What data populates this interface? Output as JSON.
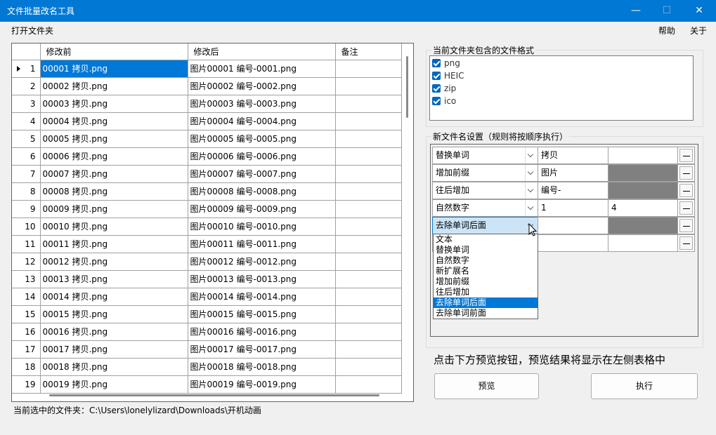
{
  "window": {
    "title": "文件批量改名工具",
    "minimize_glyph": "—",
    "maximize_glyph": "☐",
    "close_glyph": "✕"
  },
  "menu": {
    "open_folder": "打开文件夹",
    "help": "帮助",
    "about": "关于"
  },
  "file_grid": {
    "columns": [
      "修改前",
      "修改后",
      "备注"
    ],
    "rows": [
      {
        "n": "1",
        "before": "00001 拷贝.png",
        "after": "图片00001 编号-0001.png",
        "note": ""
      },
      {
        "n": "2",
        "before": "00002 拷贝.png",
        "after": "图片00002 编号-0002.png",
        "note": ""
      },
      {
        "n": "3",
        "before": "00003 拷贝.png",
        "after": "图片00003 编号-0003.png",
        "note": ""
      },
      {
        "n": "4",
        "before": "00004 拷贝.png",
        "after": "图片00004 编号-0004.png",
        "note": ""
      },
      {
        "n": "5",
        "before": "00005 拷贝.png",
        "after": "图片00005 编号-0005.png",
        "note": ""
      },
      {
        "n": "6",
        "before": "00006 拷贝.png",
        "after": "图片00006 编号-0006.png",
        "note": ""
      },
      {
        "n": "7",
        "before": "00007 拷贝.png",
        "after": "图片00007 编号-0007.png",
        "note": ""
      },
      {
        "n": "8",
        "before": "00008 拷贝.png",
        "after": "图片00008 编号-0008.png",
        "note": ""
      },
      {
        "n": "9",
        "before": "00009 拷贝.png",
        "after": "图片00009 编号-0009.png",
        "note": ""
      },
      {
        "n": "10",
        "before": "00010 拷贝.png",
        "after": "图片00010 编号-0010.png",
        "note": ""
      },
      {
        "n": "11",
        "before": "00011 拷贝.png",
        "after": "图片00011 编号-0011.png",
        "note": ""
      },
      {
        "n": "12",
        "before": "00012 拷贝.png",
        "after": "图片00012 编号-0012.png",
        "note": ""
      },
      {
        "n": "13",
        "before": "00013 拷贝.png",
        "after": "图片00013 编号-0013.png",
        "note": ""
      },
      {
        "n": "14",
        "before": "00014 拷贝.png",
        "after": "图片00014 编号-0014.png",
        "note": ""
      },
      {
        "n": "15",
        "before": "00015 拷贝.png",
        "after": "图片00015 编号-0015.png",
        "note": ""
      },
      {
        "n": "16",
        "before": "00016 拷贝.png",
        "after": "图片00016 编号-0016.png",
        "note": ""
      },
      {
        "n": "17",
        "before": "00017 拷贝.png",
        "after": "图片00017 编号-0017.png",
        "note": ""
      },
      {
        "n": "18",
        "before": "00018 拷贝.png",
        "after": "图片00018 编号-0018.png",
        "note": ""
      },
      {
        "n": "19",
        "before": "00019 拷贝.png",
        "after": "图片00019 编号-0019.png",
        "note": ""
      }
    ]
  },
  "status": {
    "current_folder": "当前选中的文件夹：C:\\Users\\lonelylizard\\Downloads\\开机动画"
  },
  "formats": {
    "legend": "当前文件夹包含的文件格式",
    "items": [
      {
        "label": "png",
        "checked": true
      },
      {
        "label": "HEIC",
        "checked": true
      },
      {
        "label": "zip",
        "checked": true
      },
      {
        "label": "ico",
        "checked": true
      }
    ]
  },
  "rules": {
    "legend": "新文件名设置（规则将按顺序执行）",
    "rows": [
      {
        "type": "替换单词",
        "arg1": "拷贝",
        "arg2": "",
        "arg2_disabled": false
      },
      {
        "type": "增加前缀",
        "arg1": "图片",
        "arg2": "",
        "arg2_disabled": true
      },
      {
        "type": "往后增加",
        "arg1": "编号-",
        "arg2": "",
        "arg2_disabled": true
      },
      {
        "type": "自然数字",
        "arg1": "1",
        "arg2": "4",
        "arg2_disabled": false
      },
      {
        "type": "去除单词后面",
        "arg1": "",
        "arg2": "",
        "arg2_disabled": true
      },
      {
        "type": "",
        "arg1": "",
        "arg2": "",
        "arg2_disabled": false
      }
    ],
    "dropdown_options": [
      "文本",
      "替换单词",
      "自然数字",
      "新扩展名",
      "增加前缀",
      "往后增加",
      "去除单词后面",
      "去除单词前面"
    ],
    "dropdown_selected_index": 6
  },
  "hint": "点击下方预览按钮，预览结果将显示在左侧表格中",
  "buttons": {
    "preview": "预览",
    "execute": "执行"
  },
  "colors": {
    "titlebar": "#0078d4",
    "selection": "#0078d7",
    "checkbox": "#0067c0"
  }
}
